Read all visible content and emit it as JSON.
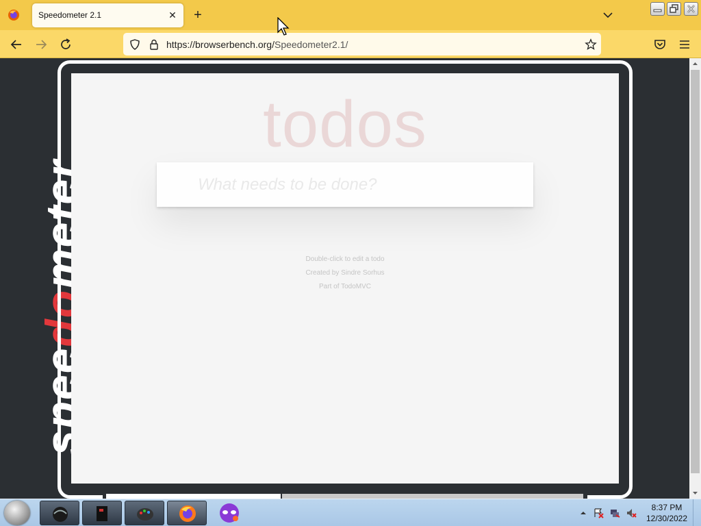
{
  "browser": {
    "tab": {
      "title": "Speedometer 2.1"
    },
    "url": {
      "host": "https://browserbench.org/",
      "path": "Speedometer2.1/"
    }
  },
  "page": {
    "logo": {
      "pre": "spee",
      "red": "do",
      "post": "meter"
    },
    "todo_app": {
      "title": "todos",
      "new_todo_placeholder": "What needs to be done?",
      "info": {
        "line1": "Double-click to edit a todo",
        "line2_prefix": "Created by ",
        "line2_link": "Sindre Sorhus",
        "line3_prefix": "Part of ",
        "line3_link": "TodoMVC"
      }
    }
  },
  "taskbar": {
    "clock": {
      "time": "8:37 PM",
      "date": "12/30/2022"
    }
  },
  "colors": {
    "tabbar": "#f3c94a",
    "navbar": "#fbd868",
    "logo_accent": "#e2383c",
    "page_bg": "#2b2f33"
  }
}
